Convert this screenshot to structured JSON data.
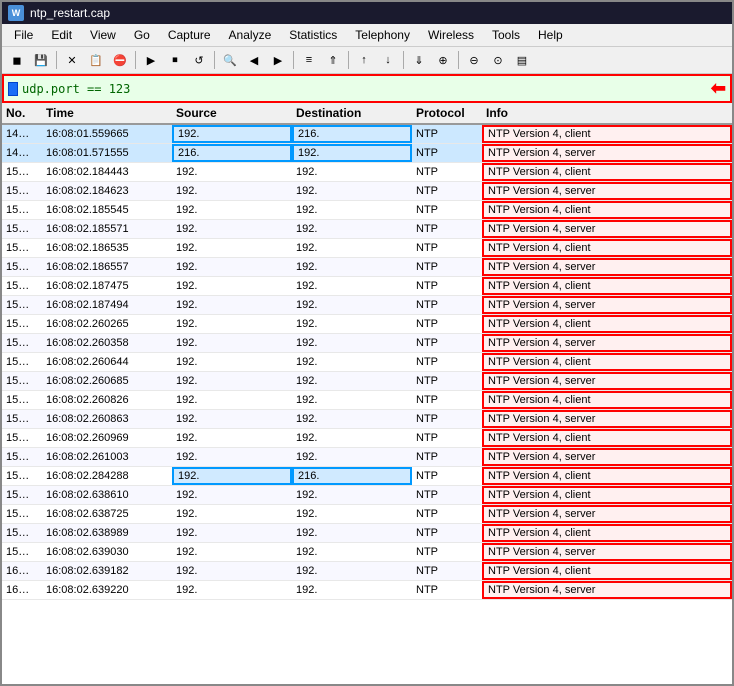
{
  "window": {
    "title": "ntp_restart.cap",
    "title_icon": "W"
  },
  "menu": {
    "items": [
      "File",
      "Edit",
      "View",
      "Go",
      "Capture",
      "Analyze",
      "Statistics",
      "Telephony",
      "Wireless",
      "Tools",
      "Help"
    ]
  },
  "toolbar": {
    "buttons": [
      {
        "name": "open-file-btn",
        "icon": "📁"
      },
      {
        "name": "save-btn",
        "icon": "💾"
      },
      {
        "name": "close-btn",
        "icon": "✖"
      },
      {
        "name": "reload-btn",
        "icon": "🔄"
      },
      {
        "name": "capture-opts-btn",
        "icon": "⚙"
      },
      {
        "name": "start-btn",
        "icon": "▶"
      },
      {
        "name": "stop-btn",
        "icon": "⬛"
      },
      {
        "name": "restart-btn",
        "icon": "↩"
      },
      {
        "name": "search-btn",
        "icon": "🔍"
      },
      {
        "name": "go-back-btn",
        "icon": "◀"
      },
      {
        "name": "go-fwd-btn",
        "icon": "▶"
      },
      {
        "name": "goto-pkt-btn",
        "icon": "≡"
      },
      {
        "name": "first-pkt-btn",
        "icon": "⤒"
      },
      {
        "name": "prev-pkt-btn",
        "icon": "↑"
      },
      {
        "name": "next-pkt-btn",
        "icon": "↓"
      },
      {
        "name": "last-pkt-btn",
        "icon": "⤓"
      },
      {
        "name": "zoom-in-btn",
        "icon": "🔍+"
      },
      {
        "name": "zoom-out-btn",
        "icon": "🔍-"
      },
      {
        "name": "zoom-normal-btn",
        "icon": "🔎"
      },
      {
        "name": "coloring-btn",
        "icon": "▦"
      }
    ]
  },
  "filter": {
    "value": "udp.port == 123",
    "arrow": "⬅"
  },
  "table": {
    "headers": [
      "No.",
      "Time",
      "Source",
      "Destination",
      "Protocol",
      "Info"
    ],
    "rows": [
      {
        "no": "14…",
        "time": "16:08:01.559665",
        "source": "192.",
        "dest": "216.",
        "proto": "NTP",
        "info": "NTP Version 4, client",
        "selected": true,
        "src_highlight": true,
        "dst_highlight": true,
        "info_red": true
      },
      {
        "no": "14…",
        "time": "16:08:01.571555",
        "source": "216.",
        "dest": "192.",
        "proto": "NTP",
        "info": "NTP Version 4, server",
        "selected": true,
        "src_highlight": true,
        "dst_highlight": true,
        "info_red": true
      },
      {
        "no": "15…",
        "time": "16:08:02.184443",
        "source": "192.",
        "dest": "192.",
        "proto": "NTP",
        "info": "NTP Version 4, client",
        "info_red": true
      },
      {
        "no": "15…",
        "time": "16:08:02.184623",
        "source": "192.",
        "dest": "192.",
        "proto": "NTP",
        "info": "NTP Version 4, server",
        "info_red": true
      },
      {
        "no": "15…",
        "time": "16:08:02.185545",
        "source": "192.",
        "dest": "192.",
        "proto": "NTP",
        "info": "NTP Version 4, client",
        "info_red": true
      },
      {
        "no": "15…",
        "time": "16:08:02.185571",
        "source": "192.",
        "dest": "192.",
        "proto": "NTP",
        "info": "NTP Version 4, server",
        "info_red": true
      },
      {
        "no": "15…",
        "time": "16:08:02.186535",
        "source": "192.",
        "dest": "192.",
        "proto": "NTP",
        "info": "NTP Version 4, client",
        "info_red": true
      },
      {
        "no": "15…",
        "time": "16:08:02.186557",
        "source": "192.",
        "dest": "192.",
        "proto": "NTP",
        "info": "NTP Version 4, server",
        "info_red": true
      },
      {
        "no": "15…",
        "time": "16:08:02.187475",
        "source": "192.",
        "dest": "192.",
        "proto": "NTP",
        "info": "NTP Version 4, client",
        "info_red": true
      },
      {
        "no": "15…",
        "time": "16:08:02.187494",
        "source": "192.",
        "dest": "192.",
        "proto": "NTP",
        "info": "NTP Version 4, server",
        "info_red": true
      },
      {
        "no": "15…",
        "time": "16:08:02.260265",
        "source": "192.",
        "dest": "192.",
        "proto": "NTP",
        "info": "NTP Version 4, client",
        "info_red": true
      },
      {
        "no": "15…",
        "time": "16:08:02.260358",
        "source": "192.",
        "dest": "192.",
        "proto": "NTP",
        "info": "NTP Version 4, server",
        "info_red": true
      },
      {
        "no": "15…",
        "time": "16:08:02.260644",
        "source": "192.",
        "dest": "192.",
        "proto": "NTP",
        "info": "NTP Version 4, client",
        "info_red": true
      },
      {
        "no": "15…",
        "time": "16:08:02.260685",
        "source": "192.",
        "dest": "192.",
        "proto": "NTP",
        "info": "NTP Version 4, server",
        "info_red": true
      },
      {
        "no": "15…",
        "time": "16:08:02.260826",
        "source": "192.",
        "dest": "192.",
        "proto": "NTP",
        "info": "NTP Version 4, client",
        "info_red": true
      },
      {
        "no": "15…",
        "time": "16:08:02.260863",
        "source": "192.",
        "dest": "192.",
        "proto": "NTP",
        "info": "NTP Version 4, server",
        "info_red": true
      },
      {
        "no": "15…",
        "time": "16:08:02.260969",
        "source": "192.",
        "dest": "192.",
        "proto": "NTP",
        "info": "NTP Version 4, client",
        "info_red": true
      },
      {
        "no": "15…",
        "time": "16:08:02.261003",
        "source": "192.",
        "dest": "192.",
        "proto": "NTP",
        "info": "NTP Version 4, server",
        "info_red": true
      },
      {
        "no": "15…",
        "time": "16:08:02.284288",
        "source": "192.",
        "dest": "216.",
        "proto": "NTP",
        "info": "NTP Version 4, client",
        "src_highlight": true,
        "dst_highlight": true,
        "info_red": true
      },
      {
        "no": "15…",
        "time": "16:08:02.638610",
        "source": "192.",
        "dest": "192.",
        "proto": "NTP",
        "info": "NTP Version 4, client",
        "info_red": true
      },
      {
        "no": "15…",
        "time": "16:08:02.638725",
        "source": "192.",
        "dest": "192.",
        "proto": "NTP",
        "info": "NTP Version 4, server",
        "info_red": true
      },
      {
        "no": "15…",
        "time": "16:08:02.638989",
        "source": "192.",
        "dest": "192.",
        "proto": "NTP",
        "info": "NTP Version 4, client",
        "info_red": true
      },
      {
        "no": "15…",
        "time": "16:08:02.639030",
        "source": "192.",
        "dest": "192.",
        "proto": "NTP",
        "info": "NTP Version 4, server",
        "info_red": true
      },
      {
        "no": "16…",
        "time": "16:08:02.639182",
        "source": "192.",
        "dest": "192.",
        "proto": "NTP",
        "info": "NTP Version 4, client",
        "info_red": true
      },
      {
        "no": "16…",
        "time": "16:08:02.639220",
        "source": "192.",
        "dest": "192.",
        "proto": "NTP",
        "info": "NTP Version 4, server",
        "info_red": true
      }
    ]
  }
}
